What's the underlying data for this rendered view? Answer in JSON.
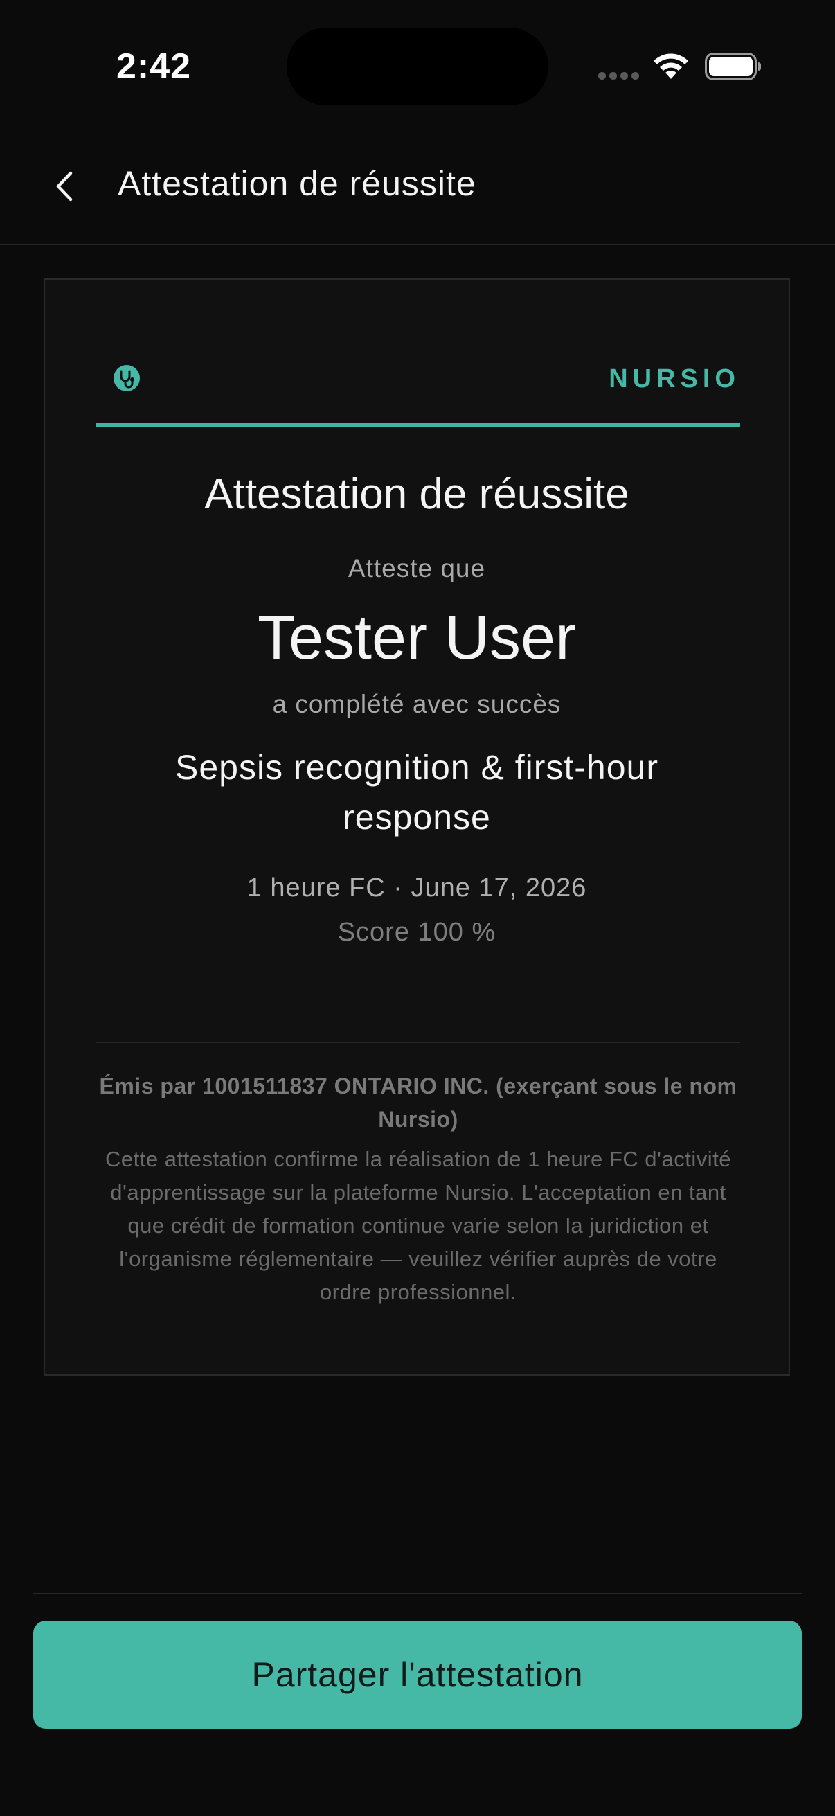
{
  "status_bar": {
    "time": "2:42",
    "icons": [
      "cellular-dots-icon",
      "wifi-icon",
      "battery-icon"
    ]
  },
  "header": {
    "back_icon": "chevron-left-icon",
    "title": "Attestation de réussite"
  },
  "certificate": {
    "brand_icon": "stethoscope-icon",
    "brand_name": "NURSIO",
    "title": "Attestation de réussite",
    "attest_label": "Atteste que",
    "recipient_name": "Tester User",
    "completed_label": "a complété avec succès",
    "course_title": "Sepsis recognition & first-hour response",
    "meta": "1 heure FC · June 17, 2026",
    "score": "Score 100 %",
    "issuer": "Émis par 1001511837 ONTARIO INC. (exerçant sous le nom Nursio)",
    "disclaimer": "Cette attestation confirme la réalisation de 1 heure FC d'activité d'apprentissage sur la plateforme Nursio. L'acceptation en tant que crédit de formation continue varie selon la juridiction et l'organisme réglementaire — veuillez vérifier auprès de votre ordre professionnel."
  },
  "actions": {
    "share_label": "Partager l'attestation"
  },
  "colors": {
    "accent": "#45b8a6",
    "background": "#0b0b0b",
    "card": "#111111"
  }
}
